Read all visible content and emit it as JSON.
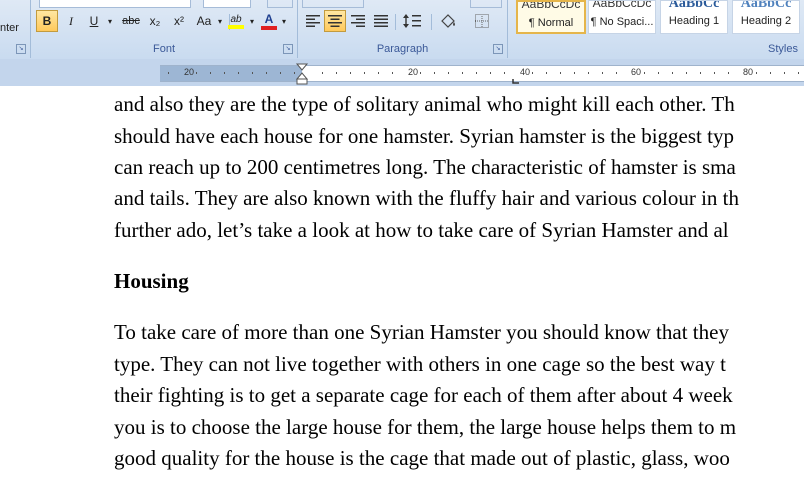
{
  "clipboard": {
    "label_fragment": "nter"
  },
  "font_group": {
    "label": "Font",
    "buttons": {
      "bold": "B",
      "italic": "I",
      "underline": "U",
      "strike": "abc",
      "subscript": "x₂",
      "superscript": "x²",
      "change_case": "Aa",
      "highlight": "ab",
      "font_color": "A"
    }
  },
  "paragraph_group": {
    "label": "Paragraph"
  },
  "styles_group": {
    "label": "Styles",
    "items": [
      {
        "sample": "AaBbCcDc",
        "name": "¶ Normal",
        "selected": true
      },
      {
        "sample": "AaBbCcDc",
        "name": "¶ No Spaci...",
        "selected": false
      },
      {
        "sample": "AaBbCc",
        "name": "Heading 1",
        "selected": false
      },
      {
        "sample": "AaBbCc",
        "name": "Heading 2",
        "selected": false
      }
    ]
  },
  "ruler": {
    "labels": [
      "20",
      "20",
      "40",
      "60",
      "80"
    ]
  },
  "document": {
    "para1": [
      "and also they are the type of solitary animal who might kill each other. Th",
      "should have each house for one hamster. Syrian hamster is the biggest typ",
      "can reach up to 200 centimetres long. The characteristic of hamster is sma",
      "and tails. They are also known with the fluffy hair and various colour in th",
      "further ado, let’s take a look at how to take care of Syrian Hamster and al"
    ],
    "heading": "Housing",
    "para2": [
      "To take care of more than one Syrian Hamster you should know that they",
      "type. They can not live together with others in one cage so the best way t",
      "their fighting is to get a separate cage for each of them after about 4 week",
      "you is to choose the large house for them, the large house helps them to m",
      "good quality for the house is the cage that made out of plastic, glass, woo"
    ]
  }
}
